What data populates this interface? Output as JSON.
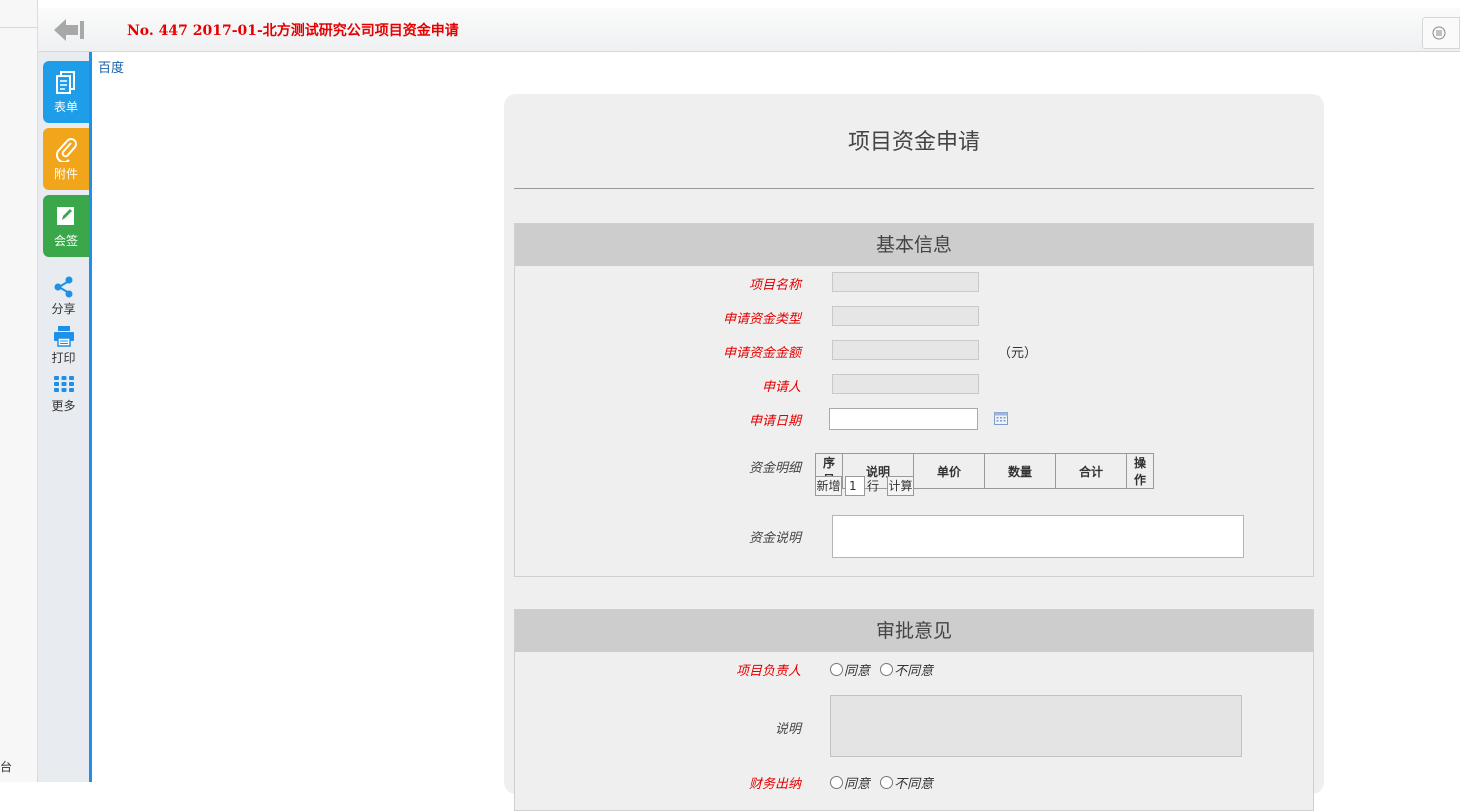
{
  "window": {
    "title": "No. 447 2017-01-北方测试研究公司项目资金申请",
    "left_edge_text": "台"
  },
  "sidebar": {
    "tiles": [
      {
        "label": "表单",
        "icon": "form-icon",
        "color": "#1e9ee8"
      },
      {
        "label": "附件",
        "icon": "paperclip-icon",
        "color": "#f1a51b"
      },
      {
        "label": "会签",
        "icon": "edit-icon",
        "color": "#3aa84a"
      }
    ],
    "tools": [
      {
        "label": "分享",
        "icon": "share-icon"
      },
      {
        "label": "打印",
        "icon": "printer-icon"
      },
      {
        "label": "更多",
        "icon": "grid-icon"
      }
    ]
  },
  "content": {
    "link": "百度",
    "form_title": "项目资金申请",
    "basic": {
      "section_title": "基本信息",
      "project_name_label": "项目名称",
      "fund_type_label": "申请资金类型",
      "amount_label": "申请资金金额",
      "amount_unit": "（元）",
      "applicant_label": "申请人",
      "date_label": "申请日期",
      "detail_label": "资金明细",
      "detail_columns": [
        "序号",
        "说明",
        "单价",
        "数量",
        "合计",
        "操作"
      ],
      "add_button": "新增",
      "row_count_value": "1",
      "row_unit": "行",
      "calc_button": "计算",
      "description_label": "资金说明"
    },
    "approval": {
      "section_title": "审批意见",
      "pm_label": "项目负责人",
      "agree": "同意",
      "disagree": "不同意",
      "remark_label": "说明",
      "finance_label": "财务出纳"
    }
  },
  "colors": {
    "title_red": "#e60000",
    "accent_blue": "#1e90e8",
    "section_gray": "#cdcdcd"
  }
}
